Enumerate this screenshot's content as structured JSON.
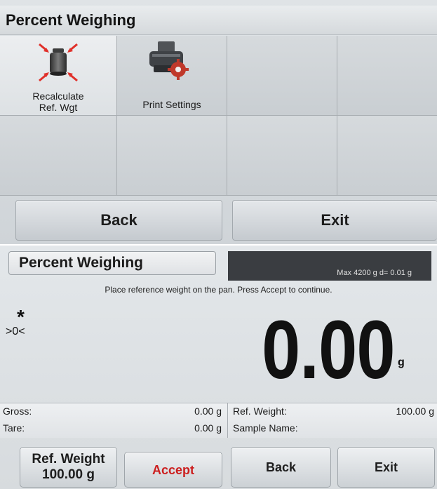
{
  "menu": {
    "title": "Percent Weighing",
    "items": [
      {
        "label_line1": "Recalculate",
        "label_line2": "Ref. Wgt",
        "icon": "weight-recalculate-icon"
      },
      {
        "label_line1": "Print Settings",
        "label_line2": "",
        "icon": "printer-settings-icon"
      }
    ],
    "back_label": "Back",
    "exit_label": "Exit"
  },
  "weighing": {
    "title": "Percent Weighing",
    "capacity_text": "Max 4200 g  d= 0.01 g",
    "instruction": "Place reference weight on the pan. Press Accept to continue.",
    "stability_indicator": "*",
    "center_zero_indicator": ">0<",
    "reading": "0.00",
    "unit": "g",
    "gross_label": "Gross:",
    "gross_value": "0.00 g",
    "tare_label": "Tare:",
    "tare_value": "0.00 g",
    "ref_weight_label": "Ref. Weight:",
    "ref_weight_value": "100.00 g",
    "sample_name_label": "Sample Name:",
    "sample_name_value": "",
    "buttons": {
      "ref_weight_line1": "Ref. Weight",
      "ref_weight_line2": "100.00 g",
      "accept": "Accept",
      "back": "Back",
      "exit": "Exit"
    },
    "accept_color": "#cc1f1f"
  }
}
